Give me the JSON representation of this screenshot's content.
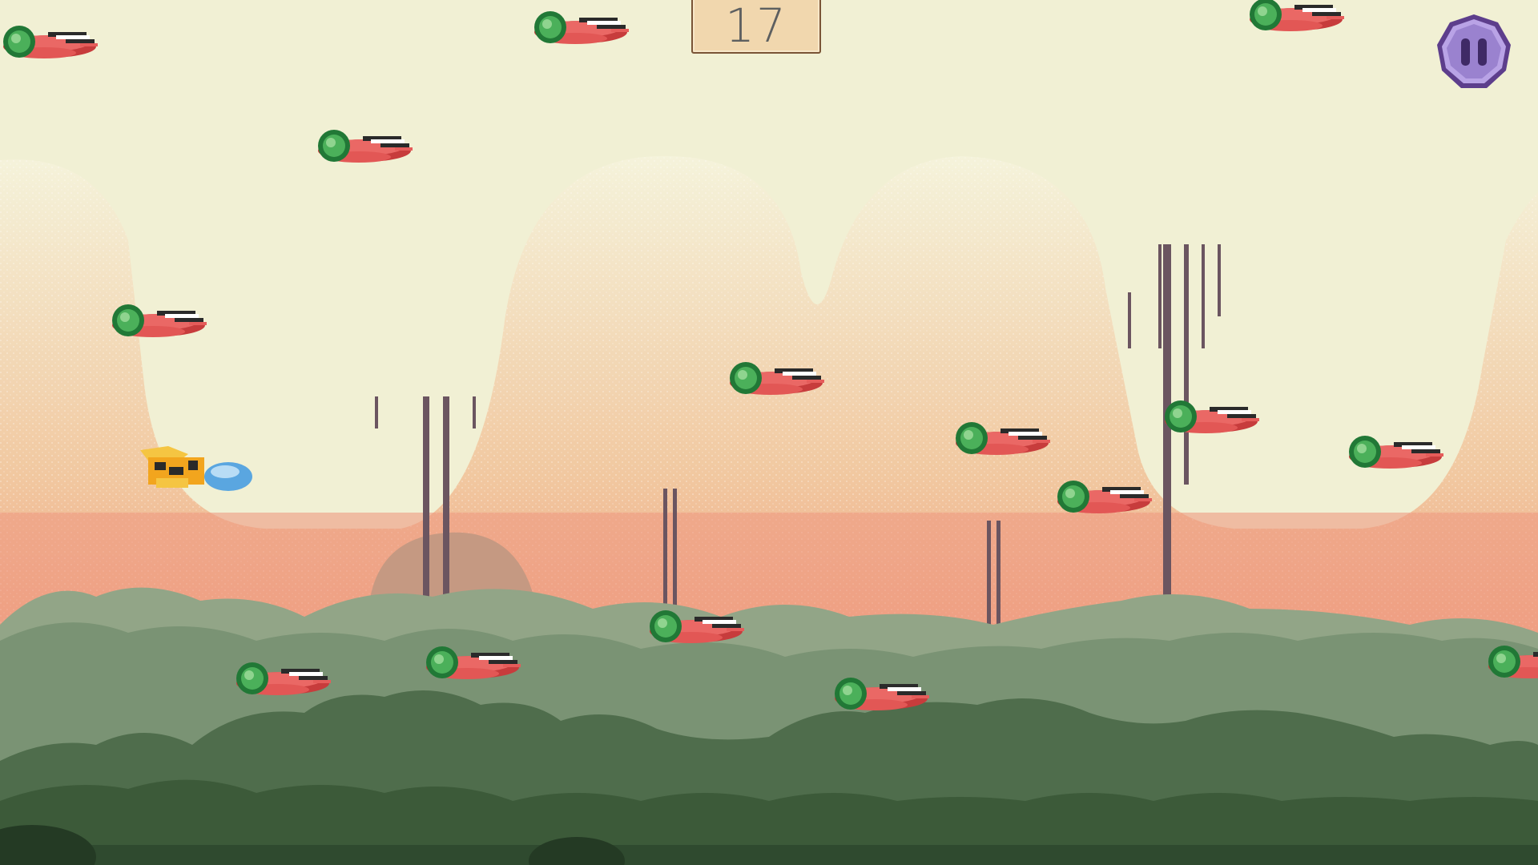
{
  "game": {
    "score": "17",
    "pause_icon": "pause-icon"
  },
  "colors": {
    "sky": "#f1f0d4",
    "mountain_light": "#f3c9a0",
    "mountain_mid": "#f0a68a",
    "hill_far": "#c59982",
    "forest_mid": "#7d947a",
    "forest_front": "#4e6a4b",
    "forest_dark": "#2f4a2f",
    "enemy_body": "#e55c5a",
    "enemy_head": "#2f9a44",
    "player_body": "#f2a51e",
    "player_nose": "#5aa6e0",
    "pause_frame": "#5d3e8c",
    "pause_fill": "#b9a3e6"
  },
  "sprites": {
    "player": "player-ship-sprite",
    "enemy": "enemy-fly-sprite"
  }
}
